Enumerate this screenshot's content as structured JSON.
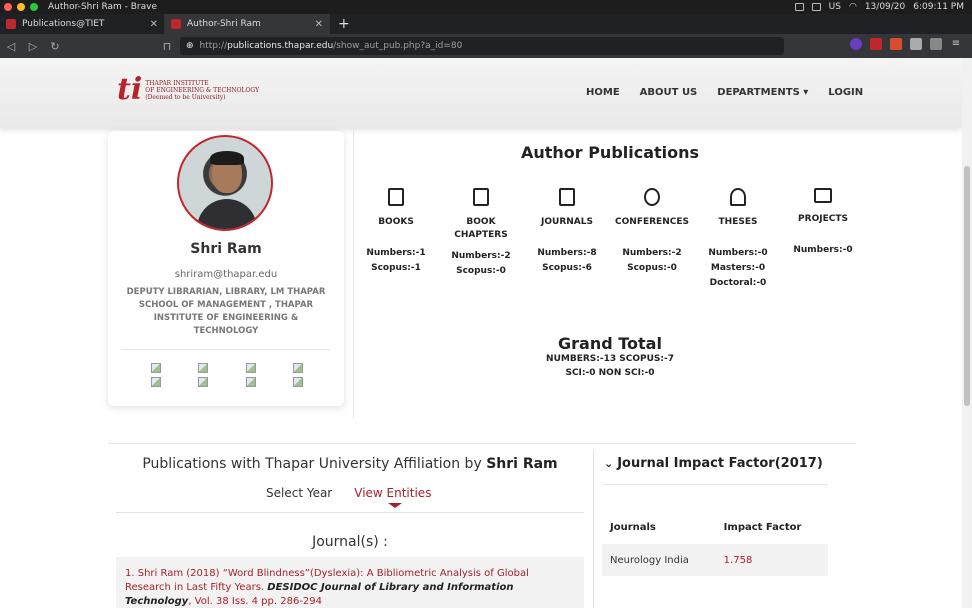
{
  "os": {
    "title": "Author-Shri Ram - Brave",
    "tray": {
      "locale": "US",
      "date": "13/09/20",
      "time": "6:09:11 PM"
    }
  },
  "tabs": [
    {
      "label": "Publications@TIET",
      "close": "✕"
    },
    {
      "label": "Author-Shri Ram",
      "close": "✕"
    }
  ],
  "address": {
    "scheme": "http://",
    "host": "publications.thapar.edu",
    "path": "/show_aut_pub.php?a_id=80"
  },
  "site": {
    "logo_mark": "ti",
    "logo_line1": "THAPAR INSTITUTE",
    "logo_line2": "OF ENGINEERING & TECHNOLOGY",
    "logo_line3": "(Deemed to be University)",
    "menu": [
      "HOME",
      "ABOUT US",
      "DEPARTMENTS ▾",
      "LOGIN"
    ]
  },
  "profile": {
    "name": "Shri Ram",
    "email": "shriram@thapar.edu",
    "designation": "DEPUTY LIBRARIAN, LIBRARY, LM THAPAR SCHOOL OF MANAGEMENT , THAPAR INSTITUTE OF ENGINEERING & TECHNOLOGY"
  },
  "stats": {
    "title": "Author Publications",
    "columns": [
      {
        "label": "BOOKS",
        "lines": [
          "Numbers:-1",
          "Scopus:-1"
        ]
      },
      {
        "label": "BOOK CHAPTERS",
        "lines": [
          "Numbers:-2",
          "Scopus:-0"
        ]
      },
      {
        "label": "JOURNALS",
        "lines": [
          "Numbers:-8",
          "Scopus:-6"
        ]
      },
      {
        "label": "CONFERENCES",
        "lines": [
          "Numbers:-2",
          "Scopus:-0"
        ]
      },
      {
        "label": "THESES",
        "lines": [
          "Numbers:-0",
          "Masters:-0",
          "Doctoral:-0"
        ]
      },
      {
        "label": "PROJECTS",
        "lines": [
          "Numbers:-0"
        ]
      }
    ],
    "grand_title": "Grand Total",
    "grand_line1": "NUMBERS:-13 SCOPUS:-7",
    "grand_line2": "SCI:-0 NON SCI:-0"
  },
  "affiliation": {
    "prefix": "Publications with Thapar University Affiliation by ",
    "name": "Shri Ram",
    "tab_select": "Select Year",
    "tab_view": "View Entities",
    "journal_heading": "Journal(s) :"
  },
  "entry": {
    "num": "1. ",
    "author": "Shri Ram",
    "text": " (2018) “Word Blindness”(Dyslexia): A Bibliometric Analysis of Global Research in Last Fifty Years. ",
    "journal": "DESIDOC Journal of Library and Information Technology",
    "tail": ", Vol. 38 Iss. 4 pp. 286-294"
  },
  "impact": {
    "heading": "Journal Impact Factor(2017)",
    "col1": "Journals",
    "col2": "Impact Factor",
    "rows": [
      {
        "journal": "Neurology India",
        "factor": "1.758"
      }
    ]
  }
}
